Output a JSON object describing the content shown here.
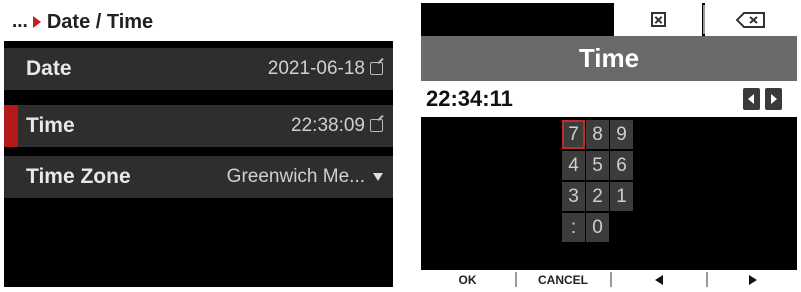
{
  "left": {
    "breadcrumb": {
      "prefix": "...",
      "title": "Date / Time"
    },
    "rows": [
      {
        "label": "Date",
        "value": "2021-06-18",
        "icon": "edit-icon"
      },
      {
        "label": "Time",
        "value": "22:38:09",
        "icon": "edit-icon"
      },
      {
        "label": "Time Zone",
        "value": "Greenwich Me...",
        "icon": "dropdown-caret-icon"
      }
    ],
    "colors": {
      "selection": "#b51a1a",
      "row_bg": "#2e2e2e"
    }
  },
  "right": {
    "title": "Time",
    "input_value": "22:34:11",
    "keypad": [
      "7",
      "8",
      "9",
      "4",
      "5",
      "6",
      "3",
      "2",
      "1",
      ":",
      "0"
    ],
    "active_key": "7",
    "bottom": {
      "ok": "OK",
      "cancel": "CANCEL"
    },
    "icons": [
      "clear-icon",
      "backspace-icon",
      "cursor-left-icon",
      "cursor-right-icon",
      "left-arrow-icon",
      "right-arrow-icon"
    ]
  }
}
